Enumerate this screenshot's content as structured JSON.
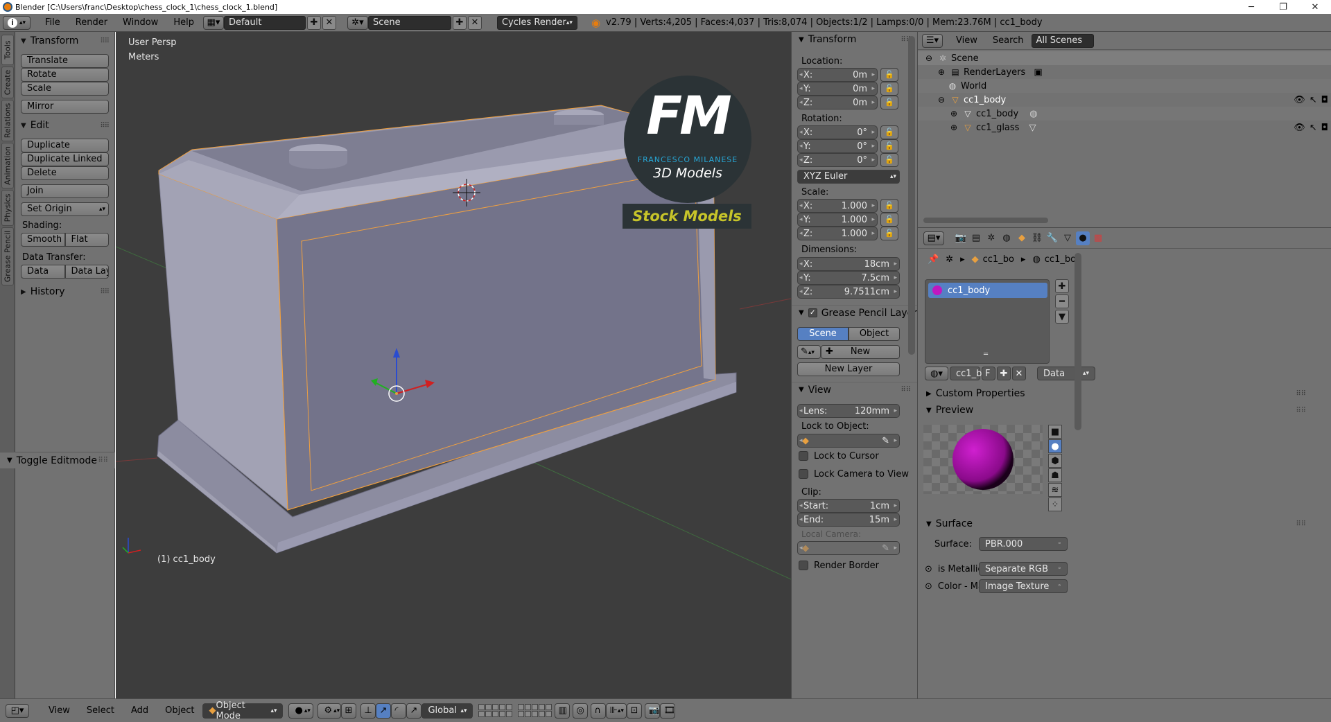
{
  "window": {
    "title": "Blender  [C:\\Users\\franc\\Desktop\\chess_clock_1\\chess_clock_1.blend]",
    "minimize": "─",
    "maximize": "❐",
    "close": "✕"
  },
  "topbar": {
    "menus": [
      "File",
      "Render",
      "Window",
      "Help"
    ],
    "layout": "Default",
    "scene": "Scene",
    "engine": "Cycles Render",
    "stats": "v2.79 | Verts:4,205 | Faces:4,037 | Tris:8,074 | Objects:1/2 | Lamps:0/0 | Mem:23.76M | cc1_body"
  },
  "tabs": [
    "Tools",
    "Create",
    "Relations",
    "Animation",
    "Physics",
    "Grease Pencil"
  ],
  "toolshelf": {
    "transform_title": "Transform",
    "translate": "Translate",
    "rotate": "Rotate",
    "scale": "Scale",
    "mirror": "Mirror",
    "edit_title": "Edit",
    "duplicate": "Duplicate",
    "duplicate_linked": "Duplicate Linked",
    "delete": "Delete",
    "join": "Join",
    "set_origin": "Set Origin",
    "shading_label": "Shading:",
    "smooth": "Smooth",
    "flat": "Flat",
    "data_transfer_label": "Data Transfer:",
    "data": "Data",
    "data_layo": "Data Layo",
    "history_title": "History",
    "toggle_editmode": "Toggle Editmode"
  },
  "viewport": {
    "view_name": "User Persp",
    "units": "Meters",
    "object_label": "(1) cc1_body",
    "watermark_initials": "FM",
    "watermark_name": "FRANCESCO MILANESE",
    "watermark_sub": "3D Models",
    "watermark_banner": "Stock Models"
  },
  "npanel": {
    "transform_title": "Transform",
    "location_label": "Location:",
    "location": [
      {
        "k": "X:",
        "v": "0m"
      },
      {
        "k": "Y:",
        "v": "0m"
      },
      {
        "k": "Z:",
        "v": "0m"
      }
    ],
    "rotation_label": "Rotation:",
    "rotation": [
      {
        "k": "X:",
        "v": "0°"
      },
      {
        "k": "Y:",
        "v": "0°"
      },
      {
        "k": "Z:",
        "v": "0°"
      }
    ],
    "rotation_mode": "XYZ Euler",
    "scale_label": "Scale:",
    "scale": [
      {
        "k": "X:",
        "v": "1.000"
      },
      {
        "k": "Y:",
        "v": "1.000"
      },
      {
        "k": "Z:",
        "v": "1.000"
      }
    ],
    "dimensions_label": "Dimensions:",
    "dimensions": [
      {
        "k": "X:",
        "v": "18cm"
      },
      {
        "k": "Y:",
        "v": "7.5cm"
      },
      {
        "k": "Z:",
        "v": "9.7511cm"
      }
    ],
    "grease_title": "Grease Pencil Layer",
    "scene_btn": "Scene",
    "object_btn": "Object",
    "new_btn": "New",
    "new_layer_btn": "New Layer",
    "view_title": "View",
    "lens_k": "Lens:",
    "lens_v": "120mm",
    "lock_to_object": "Lock to Object:",
    "lock_to_cursor": "Lock to Cursor",
    "lock_camera": "Lock Camera to View",
    "clip_label": "Clip:",
    "clip_start_k": "Start:",
    "clip_start_v": "1cm",
    "clip_end_k": "End:",
    "clip_end_v": "15m",
    "local_camera": "Local Camera:",
    "render_border": "Render Border"
  },
  "outliner": {
    "view": "View",
    "search": "Search",
    "all_scenes": "All Scenes",
    "rows": [
      "Scene",
      "RenderLayers",
      "World",
      "cc1_body",
      "cc1_body",
      "cc1_glass"
    ]
  },
  "props": {
    "crumb_object": "cc1_bo",
    "crumb_material": "cc1_bo",
    "material_slot": "cc1_body",
    "mat_name": "cc1_b",
    "mat_f": "F",
    "data_select": "Data",
    "custom_props": "Custom Properties",
    "preview": "Preview",
    "surface_title": "Surface",
    "surface_label": "Surface:",
    "surface_value": "PBR.000",
    "is_metallic_label": "is Metallic",
    "is_metallic_value": "Separate RGB",
    "color_label": "Color - Ma",
    "color_value": "Image Texture"
  },
  "bottombar": {
    "menus": [
      "View",
      "Select",
      "Add",
      "Object"
    ],
    "mode": "Object Mode",
    "orientation": "Global"
  },
  "colors": {
    "ui_bg": "#727272",
    "viewport_bg": "#3d3d3d",
    "selection_orange": "#f0a040",
    "active_blue": "#5680c2",
    "mesh_gray": "#8a8a9e"
  }
}
